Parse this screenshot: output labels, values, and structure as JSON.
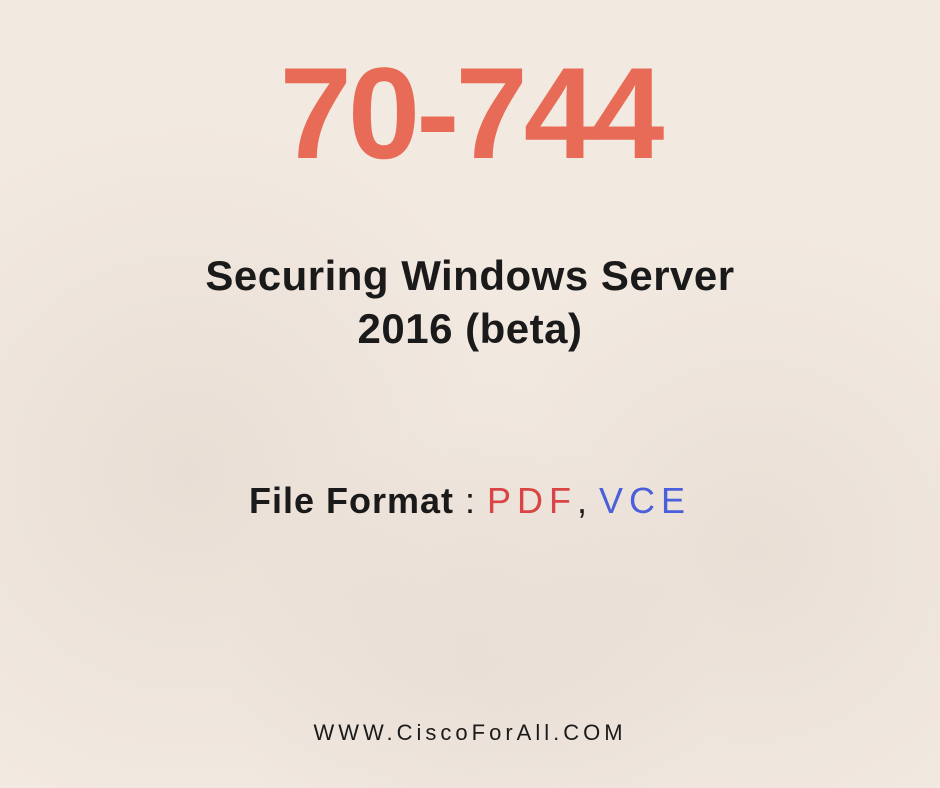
{
  "exam_code": "70-744",
  "exam_title_line1": "Securing Windows Server",
  "exam_title_line2": "2016 (beta)",
  "file_format_label": "File Format",
  "file_format_colon": " : ",
  "format_pdf": "PDF",
  "format_comma": ", ",
  "format_vce": "VCE",
  "website": "WWW.CiscoForAll.COM"
}
